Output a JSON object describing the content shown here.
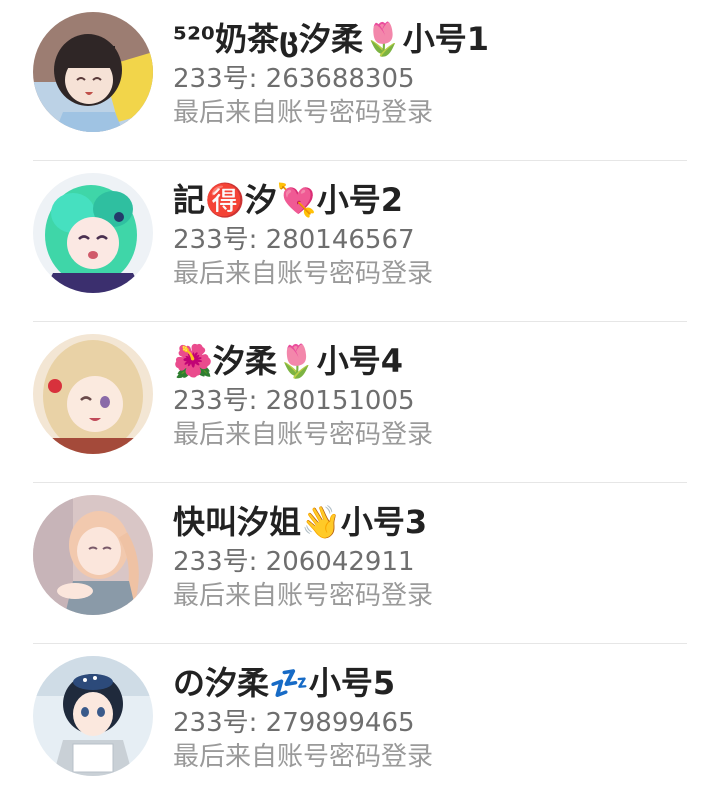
{
  "accounts": [
    {
      "name": "⁵²⁰奶茶ც汐柔🌷小号1",
      "uid_label": "233号: 263688305",
      "source": "最后来自账号密码登录"
    },
    {
      "name": "記🉐汐💘小号2",
      "uid_label": "233号: 280146567",
      "source": "最后来自账号密码登录"
    },
    {
      "name": "🌺汐柔🌷小号4",
      "uid_label": "233号: 280151005",
      "source": "最后来自账号密码登录"
    },
    {
      "name": "快叫汐姐👋小号3",
      "uid_label": "233号: 206042911",
      "source": "最后来自账号密码登录"
    },
    {
      "name": "の汐柔💤小号5",
      "uid_label": "233号: 279899465",
      "source": "最后来自账号密码登录"
    }
  ]
}
